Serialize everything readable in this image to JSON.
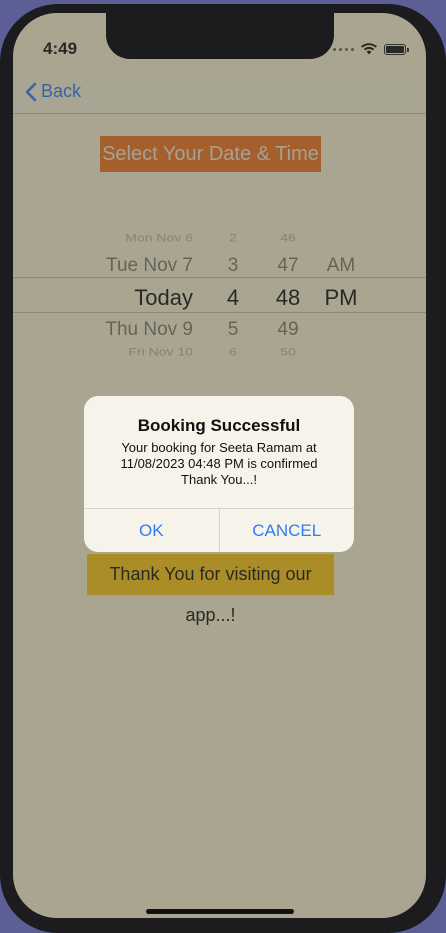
{
  "status": {
    "time": "4:49"
  },
  "nav": {
    "back_label": "Back"
  },
  "page": {
    "title": "Select Your Date & Time",
    "thanks_message": "Thank You for visiting our app...!"
  },
  "picker": {
    "rows": [
      {
        "date": "Mon Nov 6",
        "hour": "2",
        "minute": "46",
        "ampm": ""
      },
      {
        "date": "Tue Nov 7",
        "hour": "3",
        "minute": "47",
        "ampm": "AM"
      },
      {
        "date": "Today",
        "hour": "4",
        "minute": "48",
        "ampm": "PM"
      },
      {
        "date": "Thu Nov 9",
        "hour": "5",
        "minute": "49",
        "ampm": ""
      },
      {
        "date": "Fri Nov 10",
        "hour": "6",
        "minute": "50",
        "ampm": ""
      }
    ]
  },
  "alert": {
    "title": "Booking Successful",
    "message_line1": "Your booking for Seeta Ramam at",
    "message_line2": "11/08/2023 04:48 PM is confirmed",
    "message_line3": "Thank You...!",
    "ok_label": "OK",
    "cancel_label": "CANCEL"
  },
  "colors": {
    "title_bg": "#f07322",
    "thanks_bg": "#fbc716",
    "accent": "#2f7cf6"
  },
  "icons": [
    "back-chevron-icon",
    "signal-dots-icon",
    "wifi-icon",
    "battery-icon"
  ]
}
